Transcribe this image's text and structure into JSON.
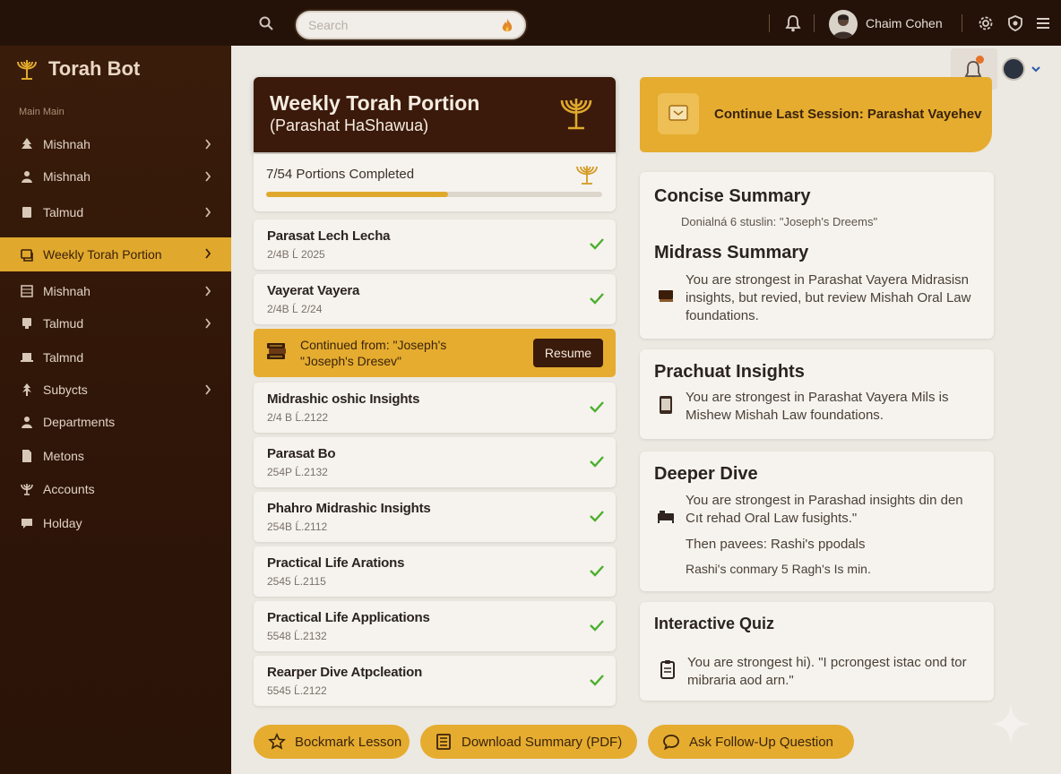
{
  "topbar": {
    "search_placeholder": "Search",
    "user_name": "Chaim Cohen"
  },
  "sidebar": {
    "brand": "Torah Bot",
    "section_label": "Main Main",
    "items": [
      {
        "label": "Mishnah",
        "icon": "tree-icon",
        "has_chevron": true
      },
      {
        "label": "Mishnah",
        "icon": "person-icon",
        "has_chevron": true
      },
      {
        "label": "Talmud",
        "icon": "book-icon",
        "has_chevron": true
      },
      {
        "label": "Weekly Torah Portion",
        "icon": "scroll-icon",
        "has_chevron": true,
        "active": true
      },
      {
        "label": "Mishnah",
        "icon": "grid-icon",
        "has_chevron": true
      },
      {
        "label": "Talmud",
        "icon": "device-icon",
        "has_chevron": true
      },
      {
        "label": "Talmnd",
        "icon": "laptop-icon",
        "has_chevron": false
      },
      {
        "label": "Subycts",
        "icon": "leaf-icon",
        "has_chevron": true
      },
      {
        "label": "Departments",
        "icon": "person-icon",
        "has_chevron": false
      },
      {
        "label": "Metons",
        "icon": "document-icon",
        "has_chevron": false
      },
      {
        "label": "Accounts",
        "icon": "menorah-icon",
        "has_chevron": false
      },
      {
        "label": "Holday",
        "icon": "chat-icon",
        "has_chevron": false
      }
    ]
  },
  "portion": {
    "title": "Weekly Torah Portion",
    "subtitle": "(Parashat HaShawua)",
    "progress_text": "7/54 Portions Completed",
    "progress_fraction": 0.54,
    "lessons": [
      {
        "title": "Parasat Lech Lecha",
        "date": "2/4B Ĺ 2025"
      },
      {
        "title": "Vayerat Vayera",
        "date": "2/4B Ĺ 2/24"
      },
      {
        "title": "Midrashic oshic Insights",
        "date": "2/4 B Ĺ.2122"
      },
      {
        "title": "Parasat Bo",
        "date": "254P Ĺ.2132"
      },
      {
        "title": "Phahro Midrashic Insights",
        "date": "254B Ĺ.2112"
      },
      {
        "title": "Practical Life Arations",
        "date": "2545 Ĺ.2115"
      },
      {
        "title": "Practical Life Applications",
        "date": "5548 Ĺ.2132"
      },
      {
        "title": "Rearper Dive Atpcleation",
        "date": "5545 Ĺ.2122"
      }
    ],
    "continued_line1": "Continued from: \"Joseph's",
    "continued_line2": "\"Joseph's Dresev\"",
    "resume_label": "Resume"
  },
  "session": {
    "continue_label": "Continue Last Session: Parashat Vayehev"
  },
  "cards": {
    "concise_title": "Concise Summary",
    "concise_body": "Donialná 6 stuslin: \"Joseph's Dreems\"",
    "midrash_title": "Midrass Summary",
    "midrash_body": "You are strongest in Parashat Vayera Midrasisn insights, but revied, but review Mishah Oral Law foundations.",
    "prachuat_title": "Prachuat Insights",
    "prachuat_body": "You are strongest in Parashat Vayera Mils is Mishew Mishah Law foundations.",
    "deeper_title": "Deeper Dive",
    "deeper_body": "You are strongest in Parashad insights  din den Cıt rehad Oral Law fusights.\"",
    "deeper_line2": "Then pavees: Rashi's ppodals",
    "deeper_line3": "Rashi's conmary 5 Ragh's Is min.",
    "quiz_title": "Interactive Quiz",
    "quiz_body": "You are strongest hi). \"I pcrongest istac ond tor mibraria aod arn.\""
  },
  "actions": {
    "bookmark": "Bockmark Lesson",
    "download": "Download Summary (PDF)",
    "ask": "Ask Follow-Up Question"
  },
  "colors": {
    "accent": "#e5ac2f",
    "dark_brown": "#3b1a0b",
    "check_green": "#4caf2e"
  }
}
